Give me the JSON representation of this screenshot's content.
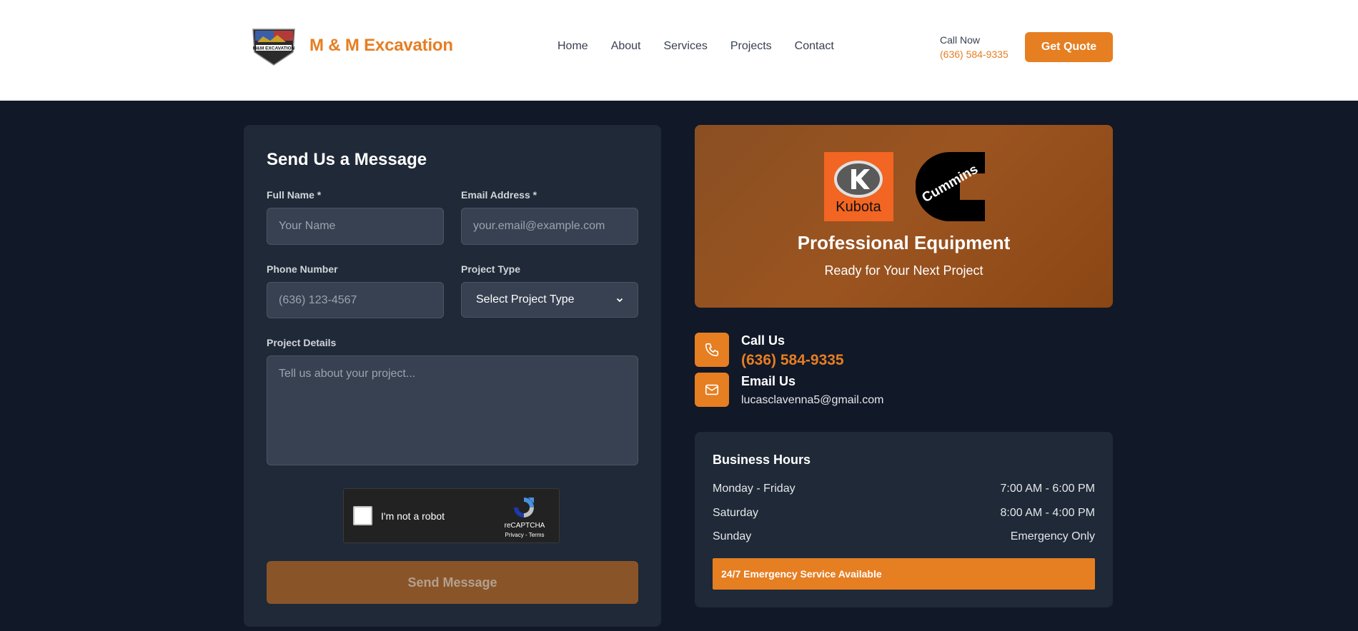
{
  "header": {
    "brand": "M & M Excavation",
    "logo_text": "M&M EXCAVATION",
    "nav": [
      "Home",
      "About",
      "Services",
      "Projects",
      "Contact"
    ],
    "call_label": "Call Now",
    "call_number": "(636) 584-9335",
    "quote_button": "Get Quote"
  },
  "form": {
    "title": "Send Us a Message",
    "full_name_label": "Full Name *",
    "full_name_placeholder": "Your Name",
    "email_label": "Email Address *",
    "email_placeholder": "your.email@example.com",
    "phone_label": "Phone Number",
    "phone_placeholder": "(636) 123-4567",
    "project_type_label": "Project Type",
    "project_type_value": "Select Project Type",
    "details_label": "Project Details",
    "details_placeholder": "Tell us about your project...",
    "recaptcha": {
      "label": "I'm not a robot",
      "brand": "reCAPTCHA",
      "links": "Privacy - Terms"
    },
    "submit": "Send Message"
  },
  "equipment": {
    "kubota_logo_text": "Kubota",
    "cummins_logo_text": "Cummins",
    "title": "Professional Equipment",
    "subtitle": "Ready for Your Next Project"
  },
  "contact": {
    "call_label": "Call Us",
    "phone": "(636) 584-9335",
    "email_label": "Email Us",
    "email": "lucasclavenna5@gmail.com"
  },
  "hours": {
    "title": "Business Hours",
    "rows": [
      {
        "day": "Monday - Friday",
        "time": "7:00 AM - 6:00 PM"
      },
      {
        "day": "Saturday",
        "time": "8:00 AM - 4:00 PM"
      },
      {
        "day": "Sunday",
        "time": "Emergency Only"
      }
    ],
    "emergency": "24/7 Emergency Service Available"
  },
  "colors": {
    "accent": "#e67e22",
    "page_bg": "#111827",
    "card_bg": "#1f2937",
    "input_bg": "#374151"
  },
  "icons": [
    "phone-icon",
    "mail-icon",
    "chevron-down-icon",
    "recaptcha-icon"
  ]
}
